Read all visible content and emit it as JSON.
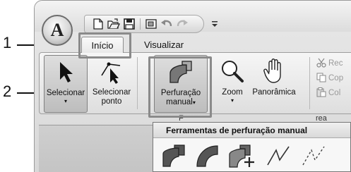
{
  "app_button": {
    "letter": "A"
  },
  "quick_access": {
    "buttons": [
      "new-file-icon",
      "open-folder-icon",
      "save-icon",
      "window-icon",
      "undo-icon",
      "redo-icon"
    ],
    "customize_icon": "dropdown-arrow-icon"
  },
  "tabs": [
    {
      "label": "Início",
      "active": true
    },
    {
      "label": "Visualizar",
      "active": false
    }
  ],
  "ribbon": {
    "tools": [
      {
        "line1": "Selecionar",
        "line2": "",
        "caret": "▾",
        "icon": "arrow-cursor-icon"
      },
      {
        "line1": "Selecionar",
        "line2": "ponto",
        "caret": "",
        "icon": "point-select-icon"
      },
      {
        "line1": "Perfuração",
        "line2": "manual",
        "caret": "▾",
        "icon": "punch-shape-icon"
      },
      {
        "line1": "Zoom",
        "line2": "",
        "caret": "▾",
        "icon": "magnifier-icon"
      },
      {
        "line1": "Panorâmica",
        "line2": "",
        "caret": "",
        "icon": "hand-icon"
      }
    ],
    "side_items": [
      {
        "label": "Rec",
        "icon": "scissors-icon"
      },
      {
        "label": "Cop",
        "icon": "copy-icon"
      },
      {
        "label": "Col",
        "icon": "paste-icon"
      }
    ],
    "group_labels": [
      "F",
      "rea"
    ]
  },
  "dropdown": {
    "title": "Ferramentas de perfuração manual",
    "items": [
      "semi-circle-outline-icon",
      "arc-band-icon",
      "shape-plus-icon",
      "zigzag-line-icon",
      "dashed-zigzag-icon"
    ]
  },
  "callouts": [
    {
      "number": "1"
    },
    {
      "number": "2"
    }
  ],
  "colors": {
    "highlight": "#8a8a8a",
    "ribbon_bg": "#e6e6e6"
  }
}
